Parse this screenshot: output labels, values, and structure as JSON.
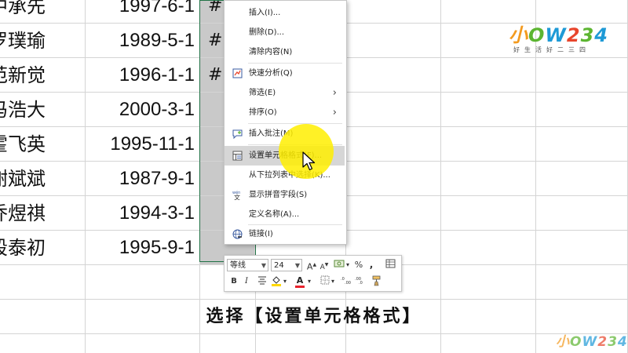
{
  "rows": [
    {
      "name": "中承先",
      "date": "1997-6-1",
      "value": "#"
    },
    {
      "name": "罗璞瑜",
      "date": "1989-5-1",
      "value": "#"
    },
    {
      "name": "范新觉",
      "date": "1996-1-1",
      "value": "#"
    },
    {
      "name": "冯浩大",
      "date": "2000-3-1",
      "value": ""
    },
    {
      "name": "霍飞英",
      "date": "1995-11-1",
      "value": ""
    },
    {
      "name": "谢斌斌",
      "date": "1987-9-1",
      "value": ""
    },
    {
      "name": "乔煜祺",
      "date": "1994-3-1",
      "value": ""
    },
    {
      "name": "段泰初",
      "date": "1995-9-1",
      "value": ""
    }
  ],
  "context_menu": {
    "items": [
      {
        "label": "插入(I)...",
        "icon": ""
      },
      {
        "label": "删除(D)...",
        "icon": ""
      },
      {
        "label": "清除内容(N)",
        "icon": ""
      },
      {
        "label": "快速分析(Q)",
        "icon": "quick-analysis-icon"
      },
      {
        "label": "筛选(E)",
        "icon": "",
        "submenu": true
      },
      {
        "label": "排序(O)",
        "icon": "",
        "submenu": true
      },
      {
        "label": "插入批注(M)",
        "icon": "insert-comment-icon"
      },
      {
        "label": "设置单元格格式(F)...",
        "icon": "format-cells-icon",
        "highlighted": true
      },
      {
        "label": "从下拉列表中选择(K)...",
        "icon": ""
      },
      {
        "label": "显示拼音字段(S)",
        "icon": "phonetic-icon"
      },
      {
        "label": "定义名称(A)...",
        "icon": ""
      },
      {
        "label": "链接(I)",
        "icon": "link-icon"
      }
    ]
  },
  "mini_toolbar": {
    "font_name": "等线",
    "font_size": "24",
    "grow_font": "A",
    "shrink_font": "A",
    "percent": "%",
    "comma": ",",
    "bold": "B",
    "italic": "I",
    "font_color": "A"
  },
  "caption": "选择【设置单元格格式】",
  "watermark": {
    "brand_parts": [
      "小",
      "O",
      "W",
      "2",
      "3",
      "4"
    ],
    "slogan": "好生活好二三四"
  },
  "colors": {
    "selection": "#c9c9c9",
    "highlight_spot": "#ffee00",
    "excel_green": "#217346",
    "fill_yellow": "#ffd800",
    "font_red": "#e8222c"
  }
}
